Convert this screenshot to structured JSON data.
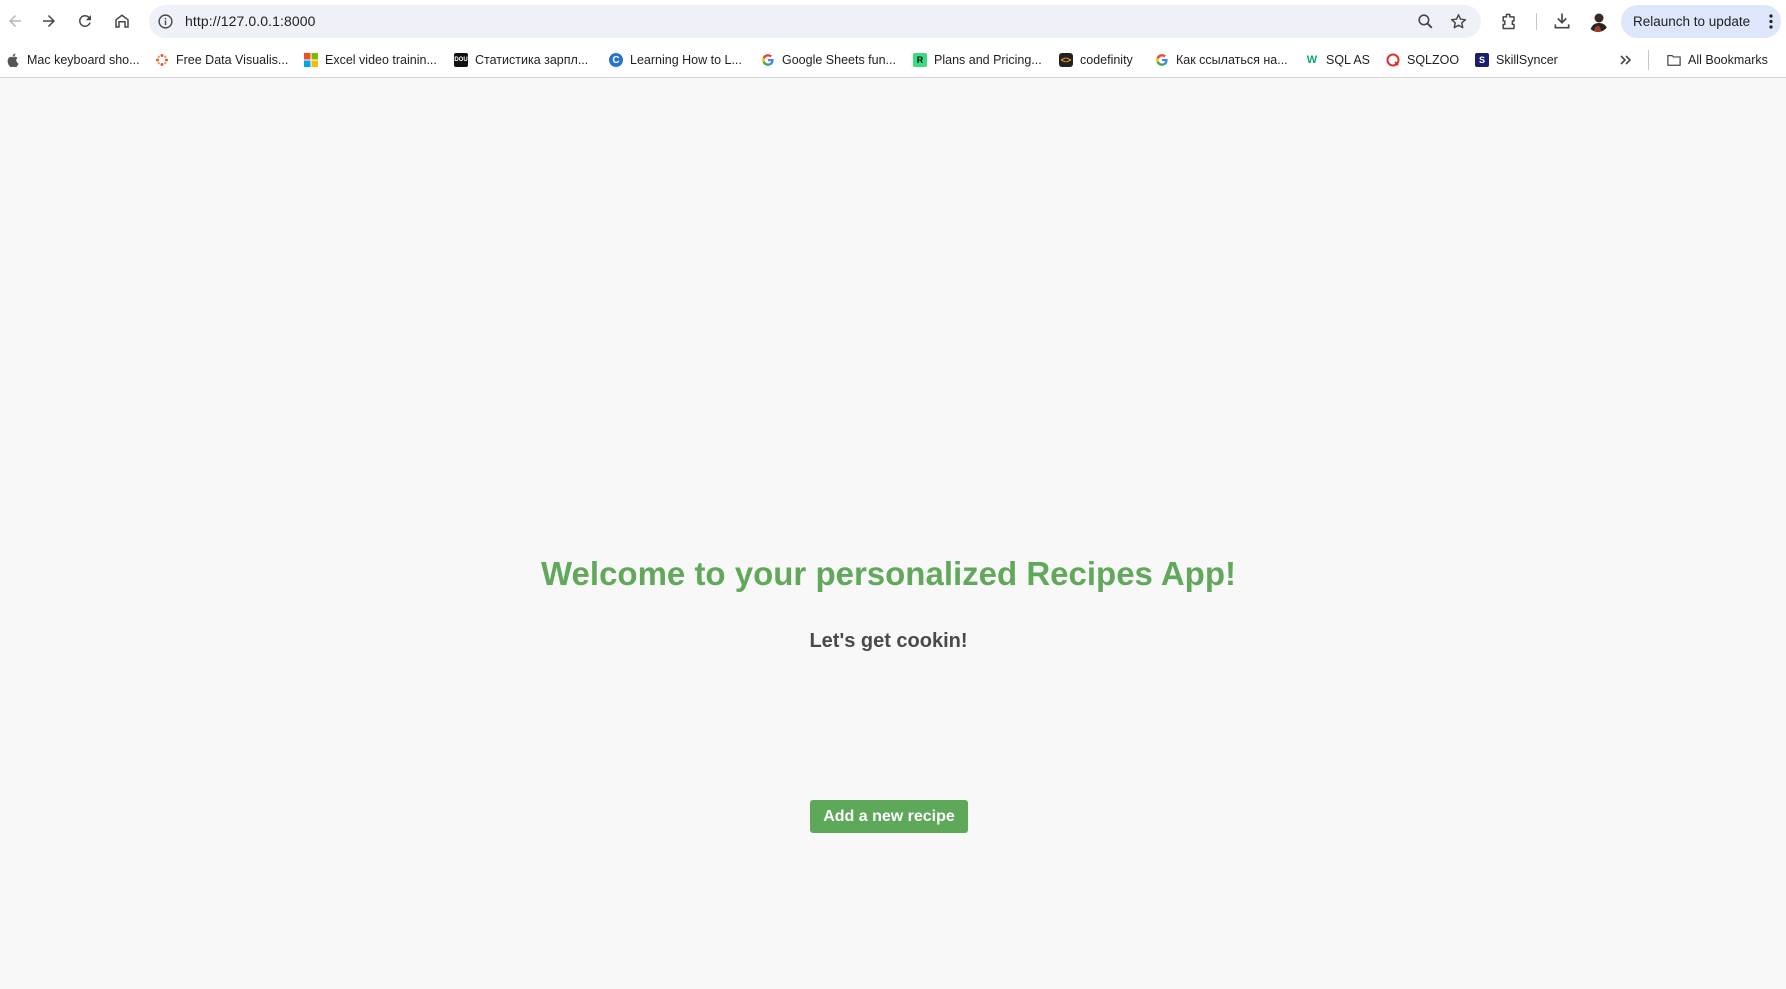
{
  "browser": {
    "url": "http://127.0.0.1:8000",
    "relaunch_label": "Relaunch to update",
    "accent_color": "#dde6fb"
  },
  "bookmarks": [
    {
      "label": "Mac keyboard sho...",
      "icon": "apple-icon"
    },
    {
      "label": "Free Data Visualis...",
      "icon": "flower-icon"
    },
    {
      "label": "Excel video trainin...",
      "icon": "microsoft-icon"
    },
    {
      "label": "Статистика зарпл...",
      "icon": "dou-icon"
    },
    {
      "label": "Learning How to L...",
      "icon": "coursera-icon"
    },
    {
      "label": "Google Sheets fun...",
      "icon": "google-icon"
    },
    {
      "label": "Plans and Pricing...",
      "icon": "rk-icon"
    },
    {
      "label": "codefinity",
      "icon": "codefinity-icon"
    },
    {
      "label": "Как ссылаться на...",
      "icon": "google-icon"
    },
    {
      "label": "SQL AS",
      "icon": "w3schools-icon"
    },
    {
      "label": "SQLZOO",
      "icon": "sqlzoo-icon"
    },
    {
      "label": "SkillSyncer",
      "icon": "skillsyncer-icon"
    }
  ],
  "all_bookmarks_label": "All Bookmarks",
  "page": {
    "title": "Welcome to your personalized Recipes App!",
    "subtitle": "Let's get cookin!",
    "add_button_label": "Add a new recipe",
    "title_color": "#62a85a",
    "button_color": "#5ea85a"
  }
}
